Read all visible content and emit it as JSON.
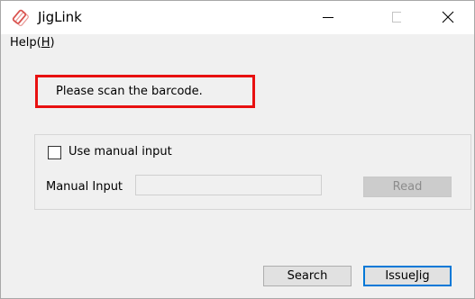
{
  "window": {
    "title": "JigLink",
    "app_icon": "jiglink-app-icon",
    "controls": [
      "minimize-icon",
      "maximize-icon",
      "close-icon"
    ]
  },
  "menubar": {
    "items": [
      {
        "label": "Help(",
        "mnemonic": "H",
        "suffix": ")"
      }
    ]
  },
  "status": {
    "message": "Please scan the barcode.",
    "highlight_color": "#e81010"
  },
  "manual_group": {
    "checkbox_label": "Use manual input",
    "checkbox_checked": false,
    "field_label": "Manual Input",
    "field_value": "",
    "read_button": "Read"
  },
  "footer": {
    "search_button": "Search",
    "issue_button": "IssueJig",
    "focus_color": "#0078d7"
  }
}
